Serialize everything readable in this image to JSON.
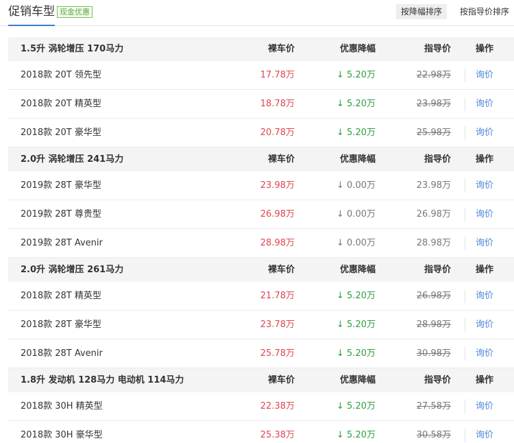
{
  "header": {
    "title": "促销车型",
    "badge": "现金优惠",
    "sort_discount": "按降幅排序",
    "sort_guide": "按指导价排序"
  },
  "columns": {
    "bare": "裸车价",
    "discount": "优惠降幅",
    "guide": "指导价",
    "op": "操作"
  },
  "groups": [
    {
      "title": "1.5升 涡轮增压 170马力",
      "rows": [
        {
          "name": "2018款 20T 领先型",
          "bare": "17.78万",
          "discount": "↓ 5.20万",
          "guide": "22.98万",
          "op": "询价",
          "has_discount": true
        },
        {
          "name": "2018款 20T 精英型",
          "bare": "18.78万",
          "discount": "↓ 5.20万",
          "guide": "23.98万",
          "op": "询价",
          "has_discount": true
        },
        {
          "name": "2018款 20T 豪华型",
          "bare": "20.78万",
          "discount": "↓ 5.20万",
          "guide": "25.98万",
          "op": "询价",
          "has_discount": true
        }
      ]
    },
    {
      "title": "2.0升 涡轮增压 241马力",
      "rows": [
        {
          "name": "2019款 28T 豪华型",
          "bare": "23.98万",
          "discount": "↓ 0.00万",
          "guide": "23.98万",
          "op": "询价",
          "has_discount": false
        },
        {
          "name": "2019款 28T 尊贵型",
          "bare": "26.98万",
          "discount": "↓ 0.00万",
          "guide": "26.98万",
          "op": "询价",
          "has_discount": false
        },
        {
          "name": "2019款 28T Avenir",
          "bare": "28.98万",
          "discount": "↓ 0.00万",
          "guide": "28.98万",
          "op": "询价",
          "has_discount": false
        }
      ]
    },
    {
      "title": "2.0升 涡轮增压 261马力",
      "rows": [
        {
          "name": "2018款 28T 精英型",
          "bare": "21.78万",
          "discount": "↓ 5.20万",
          "guide": "26.98万",
          "op": "询价",
          "has_discount": true
        },
        {
          "name": "2018款 28T 豪华型",
          "bare": "23.78万",
          "discount": "↓ 5.20万",
          "guide": "28.98万",
          "op": "询价",
          "has_discount": true
        },
        {
          "name": "2018款 28T Avenir",
          "bare": "25.78万",
          "discount": "↓ 5.20万",
          "guide": "30.98万",
          "op": "询价",
          "has_discount": true
        }
      ]
    },
    {
      "title": "1.8升 发动机 128马力 电动机 114马力",
      "rows": [
        {
          "name": "2018款 30H 精英型",
          "bare": "22.38万",
          "discount": "↓ 5.20万",
          "guide": "27.58万",
          "op": "询价",
          "has_discount": true
        },
        {
          "name": "2018款 30H 豪华型",
          "bare": "25.38万",
          "discount": "↓ 5.20万",
          "guide": "30.58万",
          "op": "询价",
          "has_discount": true
        }
      ]
    }
  ],
  "colors": {
    "accent": "#3a7bd5",
    "price_red": "#e0454f",
    "discount_green": "#2e9e3c",
    "link_blue": "#4a86d8"
  }
}
